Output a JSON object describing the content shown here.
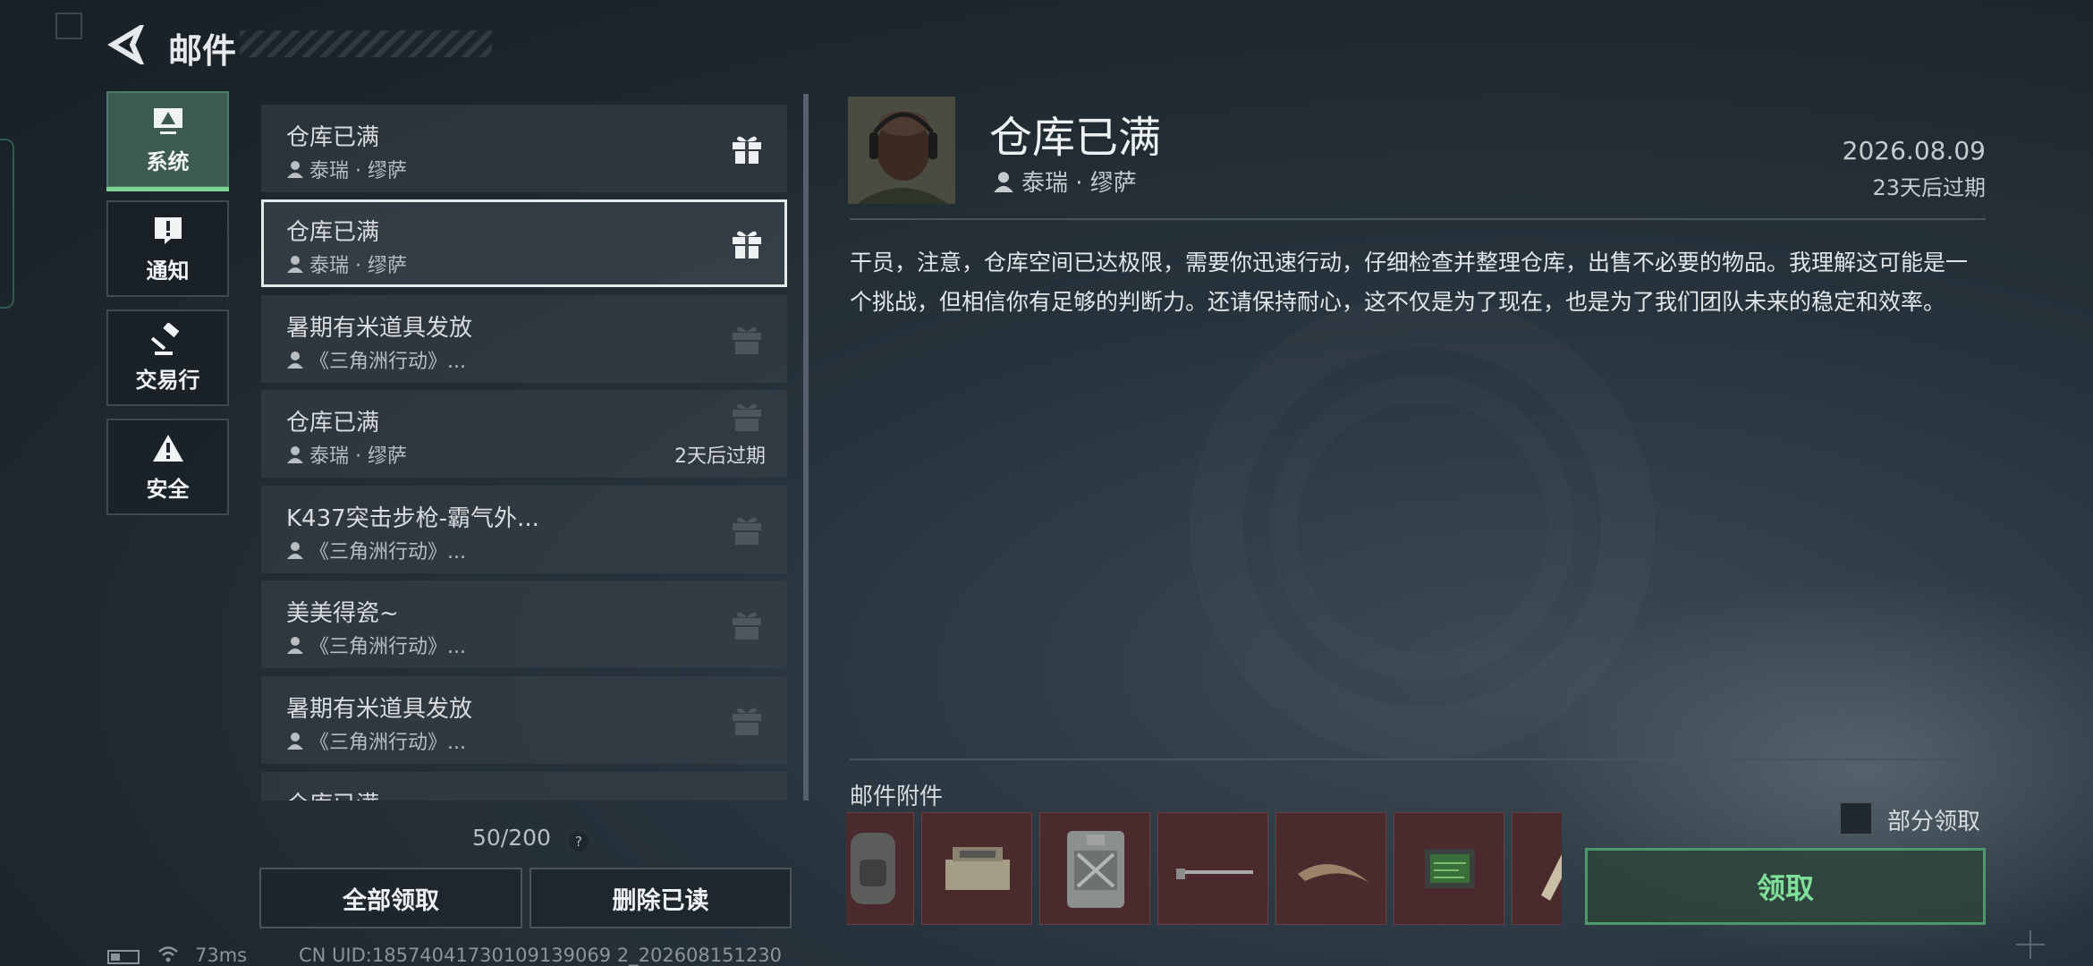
{
  "header": {
    "title": "邮件"
  },
  "categories": [
    {
      "label": "系统",
      "icon": "monitor-icon",
      "active": true
    },
    {
      "label": "通知",
      "icon": "alert-icon"
    },
    {
      "label": "交易行",
      "icon": "gavel-icon"
    },
    {
      "label": "安全",
      "icon": "warning-icon"
    }
  ],
  "mails": [
    {
      "title": "仓库已满",
      "from": "泰瑞 · 缪萨",
      "gift": "gift-icon",
      "gift_active": true
    },
    {
      "title": "仓库已满",
      "from": "泰瑞 · 缪萨",
      "gift": "gift-icon",
      "gift_active": true,
      "selected": true
    },
    {
      "title": "暑期有米道具发放",
      "from": "《三角洲行动》...",
      "gift": "gift-icon",
      "gift_active": false
    },
    {
      "title": "仓库已满",
      "from": "泰瑞 · 缪萨",
      "gift": "gift-icon",
      "gift_active": false,
      "expiry": "2天后过期"
    },
    {
      "title": "K437突击步枪-霸气外...",
      "from": "《三角洲行动》...",
      "gift": "gift-icon",
      "gift_active": false
    },
    {
      "title": "美美得瓷~",
      "from": "《三角洲行动》...",
      "gift": "gift-icon",
      "gift_active": false
    },
    {
      "title": "暑期有米道具发放",
      "from": "《三角洲行动》...",
      "gift": "gift-icon",
      "gift_active": false
    },
    {
      "title": "仓库已满",
      "from": "",
      "gift": "gift-icon",
      "gift_active": false
    }
  ],
  "list_footer": {
    "count": "50/200",
    "help": "?",
    "claim_all": "全部领取",
    "delete_read": "删除已读"
  },
  "status": {
    "ping": "73ms",
    "uid": "CN UID:18574041730109139069 2_202608151230"
  },
  "detail": {
    "title": "仓库已满",
    "from": "泰瑞 · 缪萨",
    "date": "2026.08.09",
    "expiry": "23天后过期",
    "body": "干员，注意，仓库空间已达极限，需要你迅速行动，仔细检查并整理仓库，出售不必要的物品。我理解这可能是一个挑战，但相信你有足够的判断力。还请保持耐心，这不仅是为了现在，也是为了我们团队未来的稳定和效率。",
    "attachments_label": "邮件附件",
    "attachments": [
      "backpack-icon",
      "case-icon",
      "canister-icon",
      "rifle-part-icon",
      "claw-icon",
      "circuit-board-icon",
      "frame-icon"
    ],
    "partial_claim": "部分领取",
    "claim": "领取"
  },
  "colors": {
    "accent_green": "#7fe09a",
    "attachment_bg": "#4b2a2d"
  }
}
